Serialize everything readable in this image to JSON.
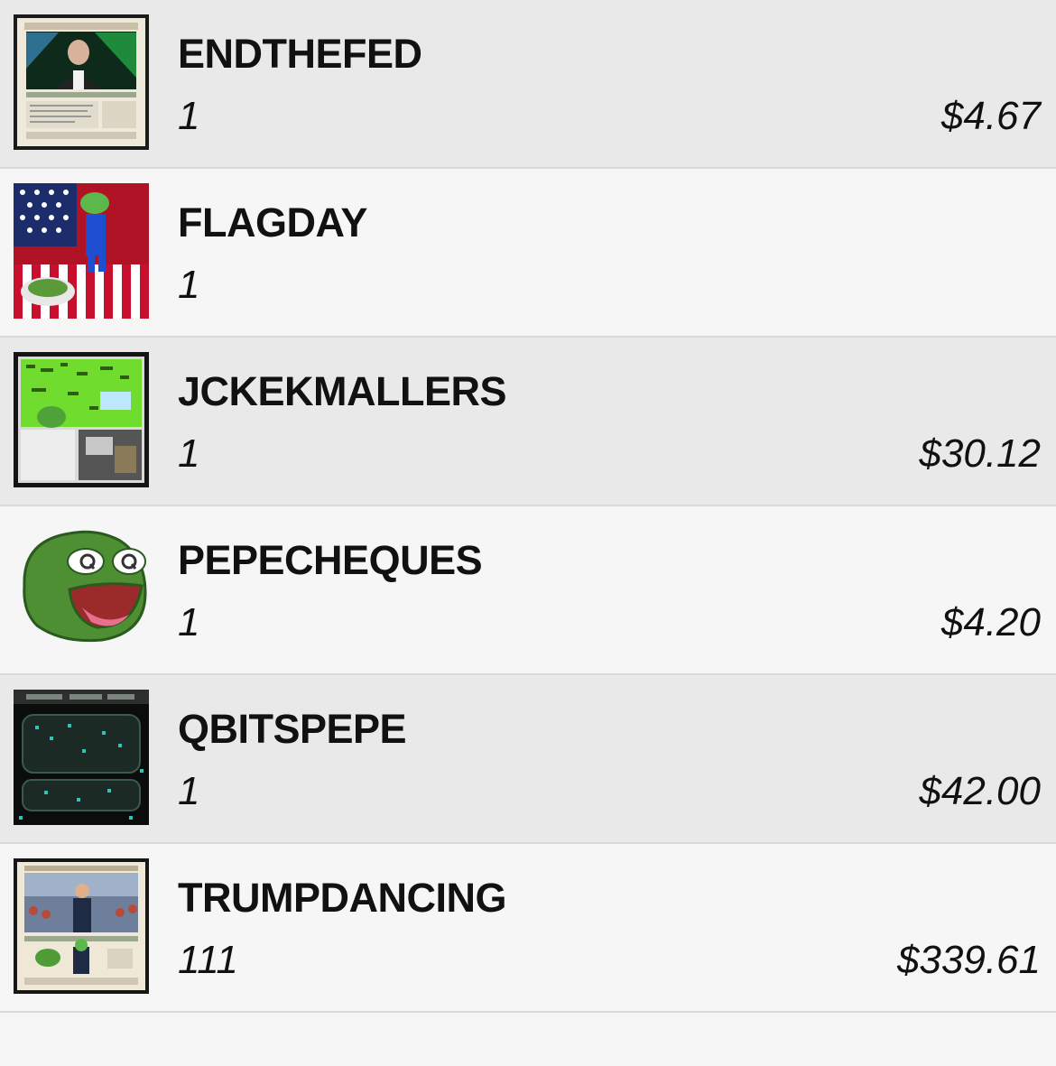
{
  "assets": [
    {
      "name": "ENDTHEFED",
      "quantity": "1",
      "value": "$4.67",
      "icon": "endthefed-card-thumbnail",
      "shade": "alt"
    },
    {
      "name": "FLAGDAY",
      "quantity": "1",
      "value": "",
      "icon": "flagday-card-thumbnail",
      "shade": "plain"
    },
    {
      "name": "JCKEKMALLERS",
      "quantity": "1",
      "value": "$30.12",
      "icon": "jckekmallers-card-thumbnail",
      "shade": "alt"
    },
    {
      "name": "PEPECHEQUES",
      "quantity": "1",
      "value": "$4.20",
      "icon": "pepecheques-card-thumbnail",
      "shade": "plain"
    },
    {
      "name": "QBITSPEPE",
      "quantity": "1",
      "value": "$42.00",
      "icon": "qbitspepe-card-thumbnail",
      "shade": "alt"
    },
    {
      "name": "TRUMPDANCING",
      "quantity": "111",
      "value": "$339.61",
      "icon": "trumpdancing-card-thumbnail",
      "shade": "plain"
    }
  ],
  "colors": {
    "row_alt": "#e9e9e9",
    "row_plain": "#f6f6f6",
    "divider": "#d9d9d9",
    "text": "#111111"
  }
}
